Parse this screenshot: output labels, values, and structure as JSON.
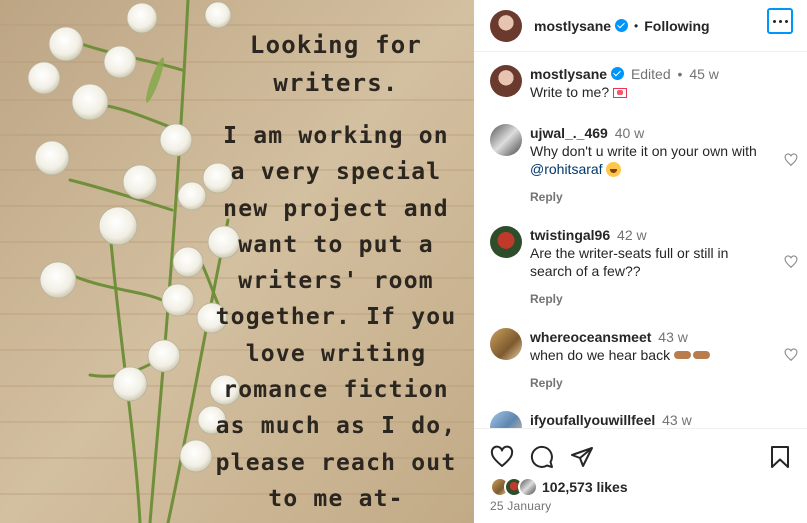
{
  "post": {
    "image": {
      "lines": [
        "Looking for",
        "writers.",
        "I am working on",
        "a very special",
        "new project and",
        "want to put a",
        "writers' room",
        "together. If you",
        "love writing",
        "romance fiction",
        "as much as I do,",
        "please reach out",
        "to me at-"
      ]
    }
  },
  "header": {
    "username": "mostlysane",
    "verified": true,
    "separator": "•",
    "follow_label": "Following",
    "more_icon": "more-horizontal-icon"
  },
  "caption": {
    "username": "mostlysane",
    "edited": "Edited",
    "separator": "•",
    "time": "45 w",
    "text": "Write to me?"
  },
  "comments": [
    {
      "username": "ujwal_._469",
      "time": "40 w",
      "text": "Why don't u write it on your own with",
      "mention": "@rohitsaraf",
      "reply_label": "Reply"
    },
    {
      "username": "twistingal96",
      "time": "42 w",
      "text": "Are the writer-seats full or still in search of a few??",
      "reply_label": "Reply"
    },
    {
      "username": "whereoceansmeet",
      "time": "43 w",
      "text": "when do we hear back",
      "reply_label": "Reply"
    },
    {
      "username": "ifyoufallyouwillfeel",
      "time": "43 w"
    }
  ],
  "actions": {
    "like_icon": "heart-icon",
    "comment_icon": "comment-icon",
    "share_icon": "send-icon",
    "save_icon": "bookmark-icon"
  },
  "likes": {
    "count_text": "102,573 likes"
  },
  "date": "25 January",
  "colors": {
    "accent": "#0095f6",
    "text": "#262626",
    "muted": "#737373",
    "link": "#00376b",
    "border": "#efefef"
  }
}
